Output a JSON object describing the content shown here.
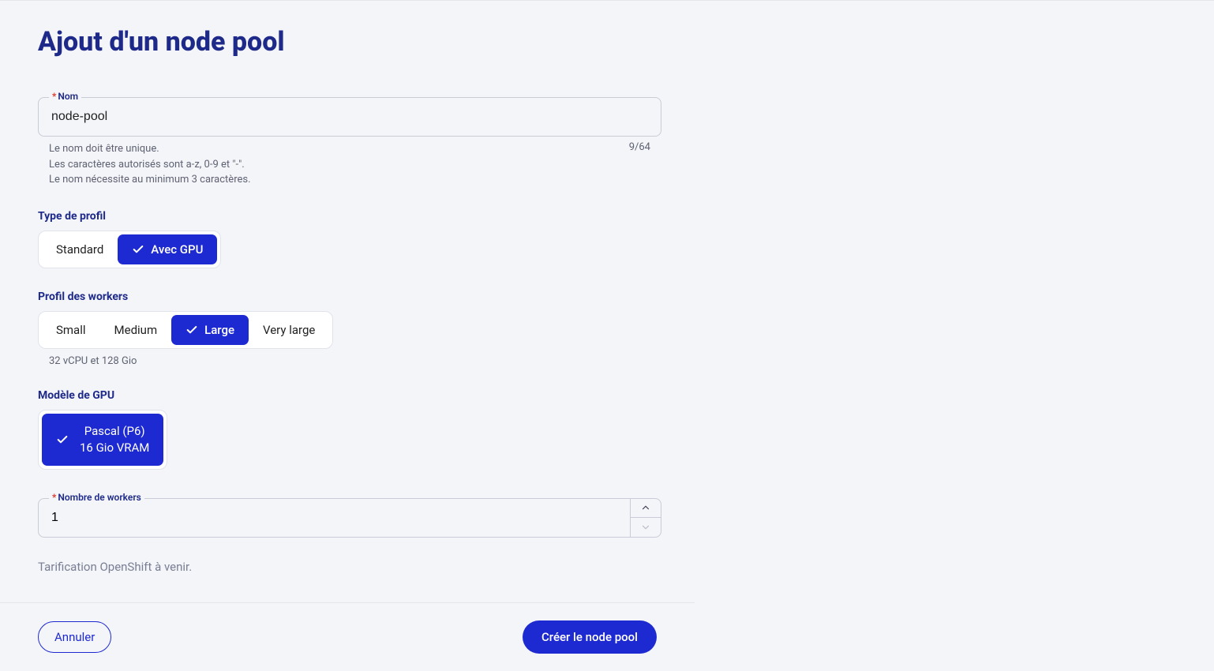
{
  "title": "Ajout d'un node pool",
  "name_field": {
    "label": "Nom",
    "value": "node-pool",
    "counter": "9/64",
    "help_line1": "Le nom doit être unique.",
    "help_line2": "Les caractères autorisés sont a-z, 0-9 et \"-\".",
    "help_line3": "Le nom nécessite au minimum 3 caractères."
  },
  "profile_type": {
    "label": "Type de profil",
    "options": [
      {
        "label": "Standard",
        "selected": false
      },
      {
        "label": "Avec GPU",
        "selected": true
      }
    ]
  },
  "worker_profile": {
    "label": "Profil des workers",
    "options": [
      {
        "label": "Small",
        "selected": false
      },
      {
        "label": "Medium",
        "selected": false
      },
      {
        "label": "Large",
        "selected": true
      },
      {
        "label": "Very large",
        "selected": false
      }
    ],
    "description": "32 vCPU et 128 Gio"
  },
  "gpu_model": {
    "label": "Modèle de GPU",
    "name": "Pascal (P6)",
    "vram": "16 Gio VRAM"
  },
  "workers_count": {
    "label": "Nombre de workers",
    "value": "1"
  },
  "pricing_note": "Tarification OpenShift à venir.",
  "footer": {
    "cancel": "Annuler",
    "submit": "Créer le node pool"
  }
}
